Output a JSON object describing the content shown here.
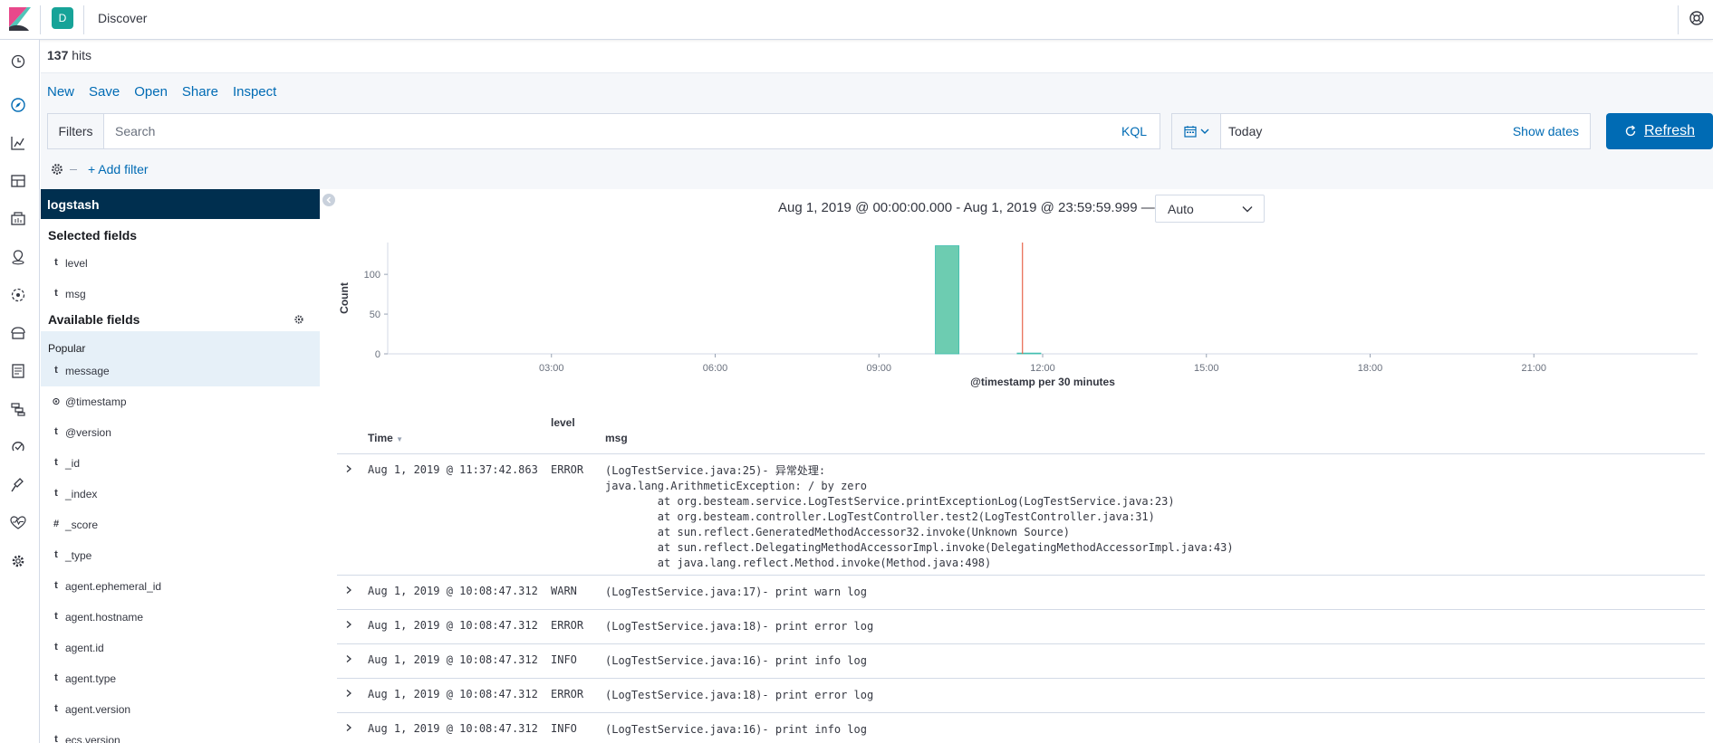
{
  "header": {
    "space_initial": "D",
    "app_title": "Discover"
  },
  "hits": {
    "count": "137",
    "label": "hits"
  },
  "menu": [
    "New",
    "Save",
    "Open",
    "Share",
    "Inspect"
  ],
  "query": {
    "filters_label": "Filters",
    "placeholder": "Search",
    "language": "KQL"
  },
  "date": {
    "value": "Today",
    "show_dates": "Show dates"
  },
  "refresh_label": "Refresh",
  "add_filter": "+ Add filter",
  "sidebar": {
    "index": "logstash",
    "selected_title": "Selected fields",
    "selected": [
      {
        "type": "t",
        "name": "level"
      },
      {
        "type": "t",
        "name": "msg"
      }
    ],
    "available_title": "Available fields",
    "popular_label": "Popular",
    "popular": [
      {
        "type": "t",
        "name": "message"
      }
    ],
    "available": [
      {
        "type": "⊙",
        "name": "@timestamp"
      },
      {
        "type": "t",
        "name": "@version"
      },
      {
        "type": "t",
        "name": "_id"
      },
      {
        "type": "t",
        "name": "_index"
      },
      {
        "type": "#",
        "name": "_score"
      },
      {
        "type": "t",
        "name": "_type"
      },
      {
        "type": "t",
        "name": "agent.ephemeral_id"
      },
      {
        "type": "t",
        "name": "agent.hostname"
      },
      {
        "type": "t",
        "name": "agent.id"
      },
      {
        "type": "t",
        "name": "agent.type"
      },
      {
        "type": "t",
        "name": "agent.version"
      },
      {
        "type": "t",
        "name": "ecs.version"
      }
    ]
  },
  "range": {
    "text": "Aug 1, 2019 @ 00:00:00.000 - Aug 1, 2019 @ 23:59:59.999 —",
    "interval": "Auto"
  },
  "chart_data": {
    "type": "bar",
    "ylabel": "Count",
    "xlabel": "@timestamp per 30 minutes",
    "ylim": [
      0,
      140
    ],
    "yticks": [
      0,
      50,
      100
    ],
    "xlim_hours": [
      0,
      24
    ],
    "xticks": [
      "03:00",
      "06:00",
      "09:00",
      "12:00",
      "15:00",
      "18:00",
      "21:00"
    ],
    "xtick_hours": [
      3,
      6,
      9,
      12,
      15,
      18,
      21
    ],
    "bars": [
      {
        "start_hour": 10.0,
        "value": 136
      },
      {
        "start_hour": 11.5,
        "value": 1
      }
    ],
    "now_marker_hour": 11.63,
    "bar_color": "#6dccb1",
    "marker_color": "#e7664c"
  },
  "table": {
    "headers": {
      "time": "Time",
      "level": "level",
      "msg": "msg"
    },
    "rows": [
      {
        "time": "Aug 1, 2019 @ 11:37:42.863",
        "level": "ERROR",
        "msg": "(LogTestService.java:25)- 异常处理:\njava.lang.ArithmeticException: / by zero\n\tat org.besteam.service.LogTestService.printExceptionLog(LogTestService.java:23)\n\tat org.besteam.controller.LogTestController.test2(LogTestController.java:31)\n\tat sun.reflect.GeneratedMethodAccessor32.invoke(Unknown Source)\n\tat sun.reflect.DelegatingMethodAccessorImpl.invoke(DelegatingMethodAccessorImpl.java:43)\n\tat java.lang.reflect.Method.invoke(Method.java:498)"
      },
      {
        "time": "Aug 1, 2019 @ 10:08:47.312",
        "level": "WARN",
        "msg": "(LogTestService.java:17)- print warn log"
      },
      {
        "time": "Aug 1, 2019 @ 10:08:47.312",
        "level": "ERROR",
        "msg": "(LogTestService.java:18)- print error log"
      },
      {
        "time": "Aug 1, 2019 @ 10:08:47.312",
        "level": "INFO",
        "msg": "(LogTestService.java:16)- print info log"
      },
      {
        "time": "Aug 1, 2019 @ 10:08:47.312",
        "level": "ERROR",
        "msg": "(LogTestService.java:18)- print error log"
      },
      {
        "time": "Aug 1, 2019 @ 10:08:47.312",
        "level": "INFO",
        "msg": "(LogTestService.java:16)- print info log"
      }
    ]
  }
}
